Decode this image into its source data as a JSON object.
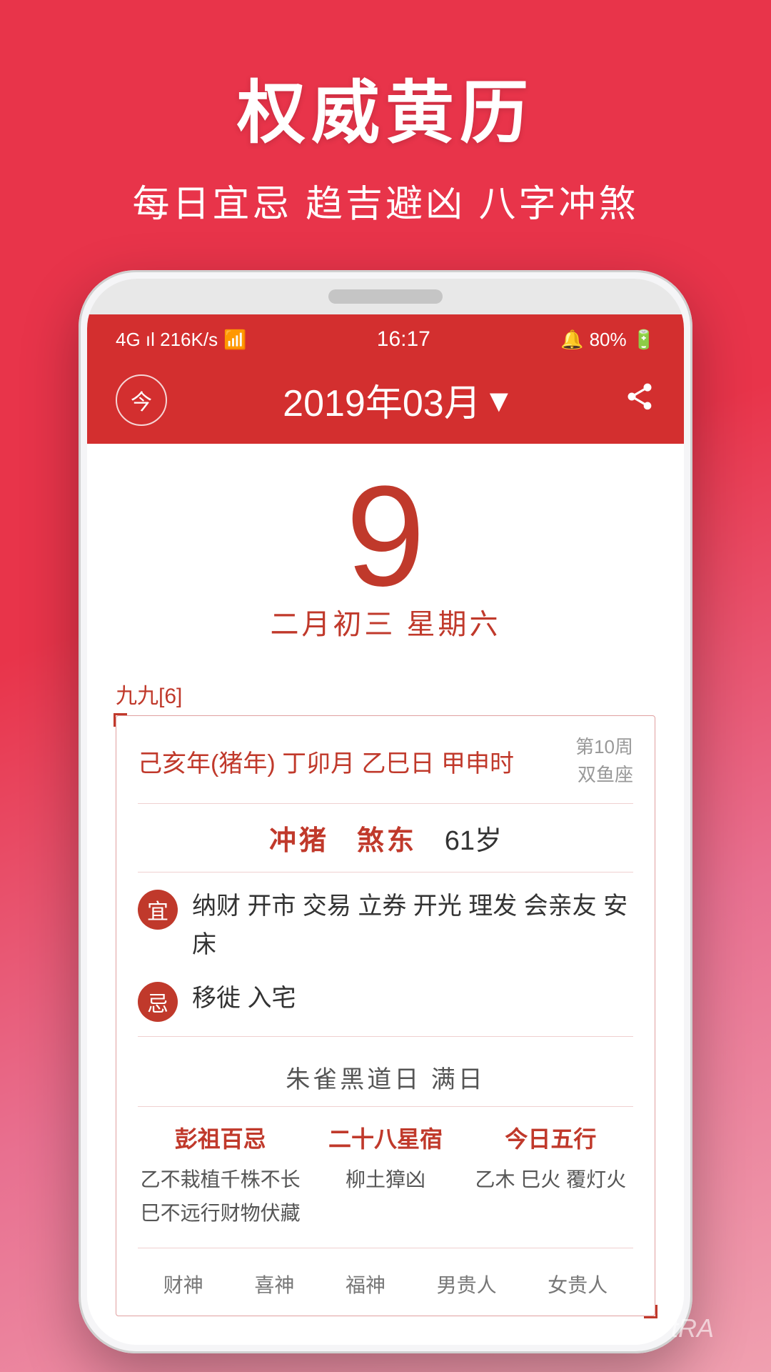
{
  "header": {
    "main_title": "权威黄历",
    "sub_title": "每日宜忌 趋吉避凶 八字冲煞"
  },
  "status_bar": {
    "signal": "4G ıl 216K/s",
    "wifi": "WiFi",
    "time": "16:17",
    "alarm": "🔕",
    "battery": "80%"
  },
  "nav": {
    "today_label": "今",
    "month_label": "2019年03月",
    "dropdown": "▾",
    "share_icon": "share"
  },
  "date": {
    "day": "9",
    "lunar": "二月初三  星期六"
  },
  "info": {
    "jiu_jiu": "九九[6]",
    "ganzhi": "己亥年(猪年) 丁卯月 乙巳日 甲申时",
    "week_num": "第10周",
    "zodiac": "双鱼座",
    "chong": "冲猪",
    "sha": "煞东",
    "age": "61岁",
    "yi_label": "宜",
    "yi_content": "纳财 开市 交易 立券 开光 理发 会亲友 安床",
    "ji_label": "忌",
    "ji_content": "移徙 入宅",
    "zhaque": "朱雀黑道日  满日",
    "col1_title": "彭祖百忌",
    "col1_line1": "乙不栽植千株不长",
    "col1_line2": "巳不远行财物伏藏",
    "col2_title": "二十八星宿",
    "col2_content": "柳土獐凶",
    "col3_title": "今日五行",
    "col3_content": "乙木 巳火 覆灯火",
    "deities": [
      "财神",
      "喜神",
      "福神",
      "男贵人",
      "女贵人"
    ]
  },
  "watermark": "tRA"
}
